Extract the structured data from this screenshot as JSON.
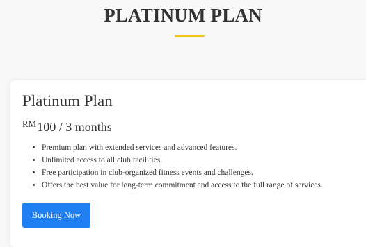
{
  "section": {
    "title": "PLATINUM PLAN"
  },
  "colors": {
    "accent": "#f5c518",
    "button": "#1e7ef2",
    "text": "#333333",
    "card": "#ffffff",
    "background": "#f8f8f8"
  },
  "plan": {
    "name": "Platinum Plan",
    "currency": "RM",
    "price": "100 / 3 months",
    "features": [
      "Premium plan with extended services and advanced features.",
      "Unlimited access to all club facilities.",
      "Free participation in club-organized fitness events and challenges.",
      "Offers the best value for long-term commitment and access to the full range of services."
    ],
    "button_label": "Booking Now"
  }
}
